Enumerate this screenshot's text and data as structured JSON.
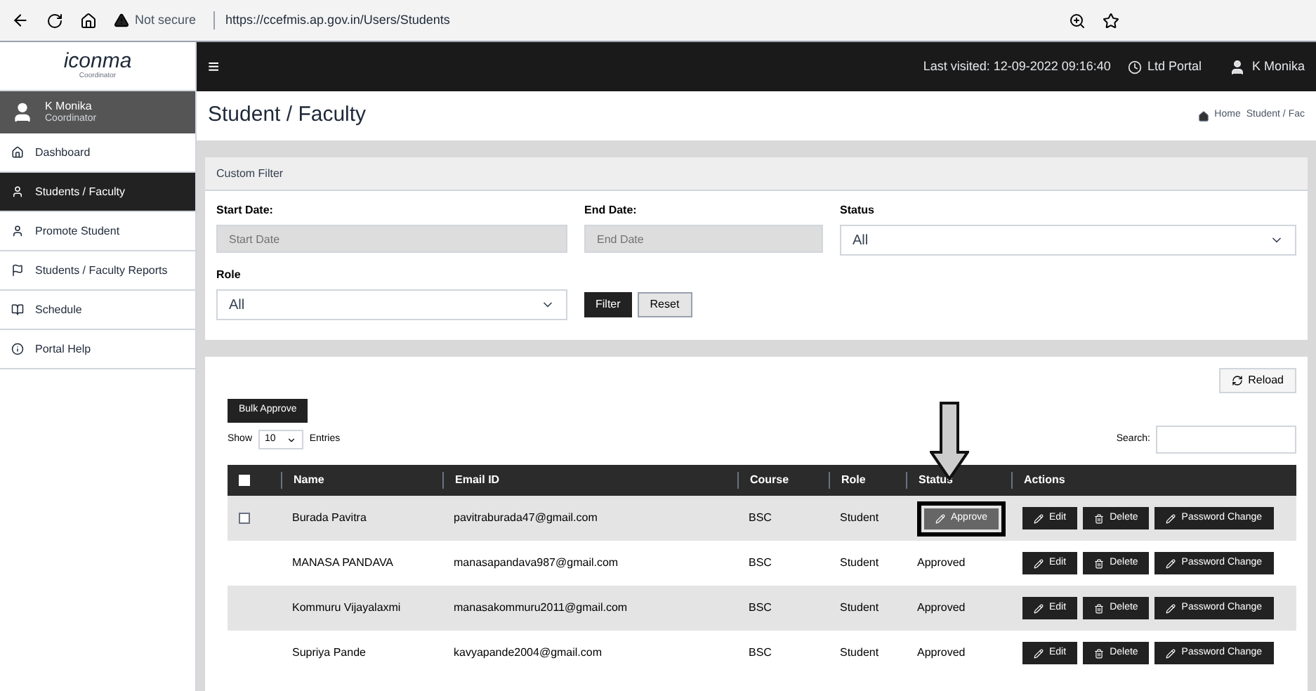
{
  "browser": {
    "security": "Not secure",
    "url": "https://ccefmis.ap.gov.in/Users/Students"
  },
  "sidebar": {
    "logo": "iconma",
    "logo_sub": "Coordinator",
    "user": {
      "name": "K Monika",
      "role": "Coordinator"
    },
    "items": [
      {
        "label": "Dashboard",
        "selected": false
      },
      {
        "label": "Students / Faculty",
        "selected": true
      },
      {
        "label": "Promote Student",
        "selected": false
      },
      {
        "label": "Students / Faculty Reports",
        "selected": false
      },
      {
        "label": "Schedule",
        "selected": false
      },
      {
        "label": "Portal Help",
        "selected": false
      }
    ]
  },
  "topbar": {
    "menu": "≡",
    "last_visited": "Last visited: 12-09-2022 09:16:40",
    "portal": "Ltd Portal",
    "user": "K Monika"
  },
  "page": {
    "title": "Student / Faculty",
    "breadcrumb": [
      "Home",
      "Student / Fac"
    ]
  },
  "filter": {
    "title": "Custom Filter",
    "start_label": "Start Date:",
    "start_placeholder": "Start Date",
    "end_label": "End Date:",
    "end_placeholder": "End Date",
    "status_label": "Status",
    "status_value": "All",
    "role_label": "Role",
    "role_value": "All",
    "filter_button": "Filter",
    "reset_button": "Reset"
  },
  "table_panel": {
    "reload": "Reload",
    "bulk": "Bulk Approve",
    "show": "Show",
    "entries_value": "10",
    "entries": "Entries",
    "search_label": "Search:"
  },
  "table": {
    "select_all_checked": false,
    "columns": [
      "Name",
      "Email ID",
      "Course",
      "Role",
      "Status",
      "Actions"
    ],
    "rows": [
      {
        "checked": false,
        "name": "Burada Pavitra",
        "email": "pavitraburada47@gmail.com",
        "course": "BSC",
        "role": "Student",
        "status": {
          "kind": "button",
          "text": "Approve"
        },
        "actions": [
          "Edit",
          "Delete",
          "Password Change"
        ]
      },
      {
        "name": "MANASA PANDAVA",
        "email": "manasapandava987@gmail.com",
        "course": "BSC",
        "role": "Student",
        "status": {
          "kind": "text",
          "text": "Approved"
        },
        "actions": [
          "Edit",
          "Delete",
          "Password Change"
        ]
      },
      {
        "name": "Kommuru Vijayalaxmi",
        "email": "manasakommuru2011@gmail.com",
        "course": "BSC",
        "role": "Student",
        "status": {
          "kind": "text",
          "text": "Approved"
        },
        "actions": [
          "Edit",
          "Delete",
          "Password Change"
        ]
      },
      {
        "name": "Supriya Pande",
        "email": "kavyapande2004@gmail.com",
        "course": "BSC",
        "role": "Student",
        "status": {
          "kind": "text",
          "text": "Approved"
        },
        "actions": [
          "Edit",
          "Delete",
          "Password Change"
        ]
      }
    ]
  }
}
